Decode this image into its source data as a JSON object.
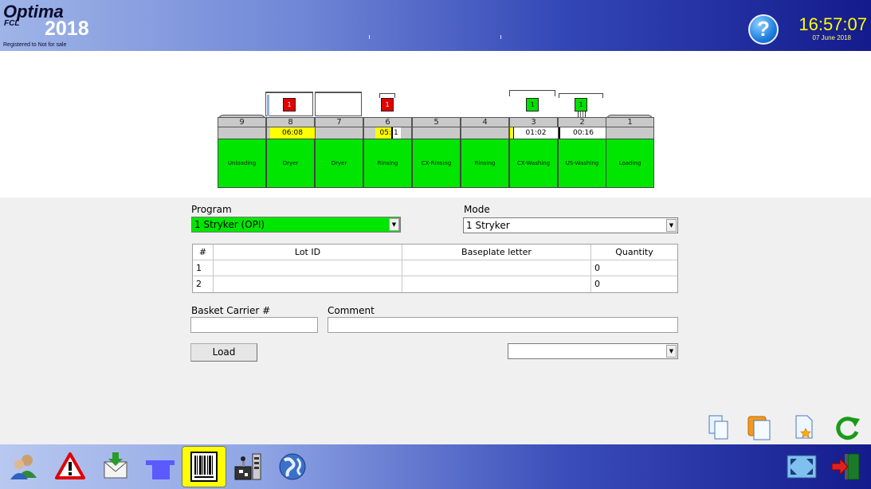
{
  "header": {
    "brand": "Optima",
    "brand_sub": "FCL",
    "brand_year": "2018",
    "registered": "Registered to Not for sale",
    "help_label": "?",
    "time": "16:57:07",
    "date": "07 June 2018"
  },
  "stations": [
    {
      "num": "9",
      "time": "",
      "label": "Unloading"
    },
    {
      "num": "8",
      "time": "06:08",
      "label": "Dryer"
    },
    {
      "num": "7",
      "time": "",
      "label": "Dryer"
    },
    {
      "num": "6",
      "time": "05:",
      "time2": "1",
      "label": "Rinsing"
    },
    {
      "num": "5",
      "time": "",
      "label": "CX-Rinsing"
    },
    {
      "num": "4",
      "time": "",
      "label": "Rinsing"
    },
    {
      "num": "3",
      "time": "01:02",
      "label": "CX-Washing"
    },
    {
      "num": "2",
      "time": "00:16",
      "label": "US-Washing"
    },
    {
      "num": "1",
      "time": "",
      "label": "Loading"
    }
  ],
  "baskets": [
    {
      "label": "1",
      "color": "#e00000"
    },
    {
      "label": "1",
      "color": "#e00000"
    },
    {
      "label": "1",
      "color": "#00e000"
    },
    {
      "label": "1",
      "color": "#00e000"
    }
  ],
  "program": {
    "label": "Program",
    "value": "1 Stryker (OPI)",
    "color": "#00e600"
  },
  "mode": {
    "label": "Mode",
    "value": "1 Stryker"
  },
  "table": {
    "headers": [
      "#",
      "Lot ID",
      "Baseplate letter",
      "Quantity"
    ],
    "rows": [
      {
        "num": "1",
        "lot": "",
        "baseplate": "",
        "qty": "0"
      },
      {
        "num": "2",
        "lot": "",
        "baseplate": "",
        "qty": "0"
      }
    ]
  },
  "basket_carrier": {
    "label": "Basket Carrier #",
    "value": ""
  },
  "comment": {
    "label": "Comment",
    "value": ""
  },
  "load_button": "Load",
  "extra_select": {
    "value": ""
  },
  "actions": [
    "copy-icon",
    "duplicate-icon",
    "new-document-icon",
    "refresh-icon"
  ],
  "toolbar": [
    "operator-icon",
    "alarm-warning-icon",
    "inbox-download-icon",
    "flag-icon",
    "barcode-icon",
    "control-panel-icon",
    "globe-icon",
    "fit-screen-icon",
    "exit-door-icon"
  ]
}
